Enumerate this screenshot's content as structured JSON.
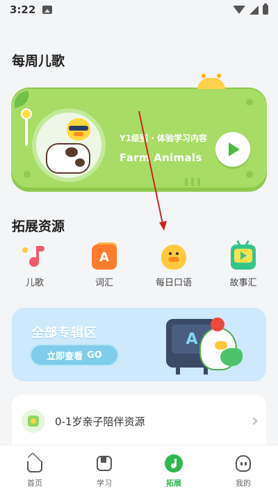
{
  "status_bar": {
    "time": "3:22"
  },
  "weekly_songs": {
    "section_title": "每周儿歌",
    "card": {
      "level_text": "Y1级别 · 体验学习内容",
      "song_title": "Farm Animals",
      "play_icon": "play-icon"
    }
  },
  "resources": {
    "section_title": "拓展资源",
    "items": [
      {
        "label": "儿歌",
        "icon": "music-note-icon"
      },
      {
        "label": "词汇",
        "icon": "letter-a-card-icon"
      },
      {
        "label": "每日口语",
        "icon": "duck-icon"
      },
      {
        "label": "故事汇",
        "icon": "tv-play-icon"
      }
    ]
  },
  "album_banner": {
    "title": "全部专辑区",
    "button_label": "立即查看",
    "button_suffix": "GO",
    "tv_text": "A"
  },
  "list": {
    "items": [
      {
        "label": "0-1岁亲子陪伴资源"
      }
    ]
  },
  "bottom_nav": {
    "items": [
      {
        "label": "首页",
        "active": false
      },
      {
        "label": "学习",
        "active": false
      },
      {
        "label": "拓展",
        "active": true
      },
      {
        "label": "我的",
        "active": false
      }
    ]
  },
  "colors": {
    "accent_green": "#2eb84e",
    "card_green": "#a7dc66",
    "banner_blue": "#cde9fb",
    "annotation_arrow": "#d42020"
  }
}
